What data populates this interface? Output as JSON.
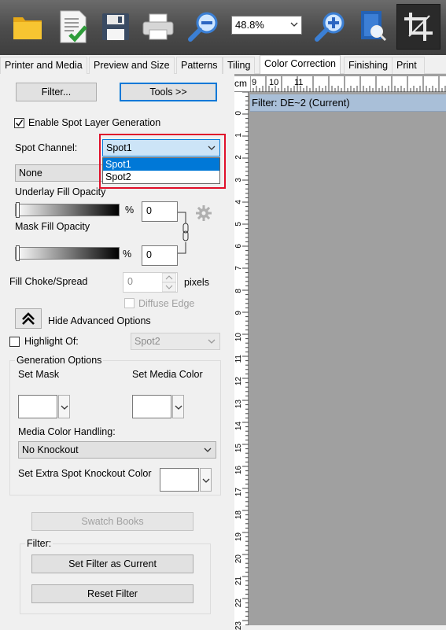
{
  "toolbar": {
    "zoom_value": "48.8%",
    "icons": [
      "open-folder-icon",
      "checklist-icon",
      "save-icon",
      "print-icon",
      "zoom-out-icon",
      "zoom-in-icon",
      "document-zoom-icon",
      "crop-icon"
    ]
  },
  "tabs": [
    {
      "label": "Printer and Media"
    },
    {
      "label": "Preview and Size"
    },
    {
      "label": "Patterns"
    },
    {
      "label": "Tiling"
    },
    {
      "label": "Color Correction"
    },
    {
      "label": "Finishing"
    },
    {
      "label": "Print"
    }
  ],
  "panel": {
    "filter_button": "Filter...",
    "tools_button": "Tools >>",
    "enable_spot_label": "Enable Spot Layer Generation",
    "spot_channel_label": "Spot Channel:",
    "spot_channel_value": "Spot1",
    "spot_options": [
      "Spot1",
      "Spot2"
    ],
    "none_combo_value": "None",
    "underlay_label": "Underlay Fill Opacity",
    "underlay_value": "0",
    "mask_label": "Mask Fill Opacity",
    "mask_value": "0",
    "percent": "%",
    "choke_label": "Fill Choke/Spread",
    "choke_value": "0",
    "pixels_label": "pixels",
    "diffuse_label": "Diffuse Edge",
    "hide_advanced_label": "Hide Advanced Options",
    "highlight_label": "Highlight Of:",
    "highlight_value": "Spot2",
    "generation_group": "Generation Options",
    "set_mask_label": "Set Mask",
    "set_media_color_label": "Set Media Color",
    "media_handling_label": "Media Color Handling:",
    "media_handling_value": "No Knockout",
    "extra_knockout_label": "Set Extra Spot Knockout Color",
    "swatch_books_button": "Swatch Books",
    "filter_group": "Filter:",
    "set_filter_button": "Set Filter as Current",
    "reset_filter_button": "Reset Filter"
  },
  "preview": {
    "ruler_unit": "cm",
    "filter_title": "Filter: DE~2 (Current)",
    "top_ticks": [
      "9",
      "10",
      "11"
    ],
    "left_ticks": [
      "0",
      "1",
      "2",
      "3",
      "4",
      "5",
      "6",
      "7",
      "8",
      "9",
      "10",
      "11",
      "12",
      "13",
      "14",
      "15",
      "16",
      "17",
      "18",
      "19",
      "20",
      "21",
      "22",
      "23"
    ]
  },
  "colors": {
    "accent": "#0078d7",
    "highlight_frame": "#e0102a",
    "filter_bar": "#a9bfd8",
    "canvas": "#a0a0a0"
  }
}
